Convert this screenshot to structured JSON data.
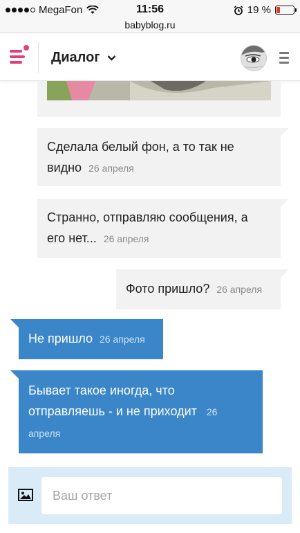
{
  "status_bar": {
    "carrier": "MegaFon",
    "time": "11:56",
    "battery": "19 %",
    "battery_level": 0.19,
    "signal_dots_filled": 4,
    "signal_dots_total": 5
  },
  "url": "babyblog.ru",
  "header": {
    "title": "Диалог"
  },
  "messages": [
    {
      "text": "Сделала белый фон, а то так не видно",
      "line1": "Сделала белый фон, а то так не",
      "line2": "видно",
      "time": "26 апреля",
      "direction": "incoming"
    },
    {
      "text": "Странно, отправляю сообщения, а его нет...",
      "line1": "Странно, отправляю сообщения, а",
      "line2": "его нет...",
      "time": "26 апреля",
      "direction": "incoming"
    },
    {
      "text": "Фото пришло?",
      "time": "26 апреля",
      "direction": "incoming"
    },
    {
      "text": "Не пришло",
      "time": "26 апреля",
      "direction": "outgoing"
    },
    {
      "text": "Бывает такое иногда, что отправляешь - и не приходит",
      "line1": "Бывает такое иногда, что",
      "line2": "отправляешь - и не приходит",
      "time_part1": "26",
      "time_part2": "апреля",
      "direction": "outgoing"
    }
  ],
  "composer": {
    "placeholder": "Ваш ответ"
  },
  "colors": {
    "accent_pink": "#e63c7c",
    "outgoing_bubble": "#3a86c9",
    "incoming_bubble": "#f2f2f2",
    "composer_bg": "#d9ebf7"
  }
}
